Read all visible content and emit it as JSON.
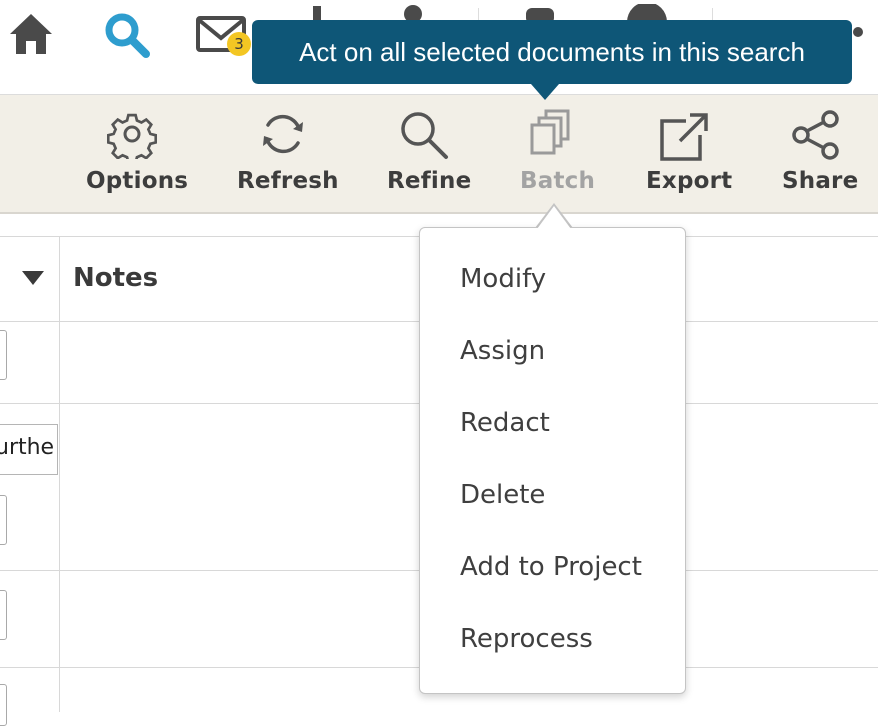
{
  "topnav": {
    "icons": [
      "home-icon",
      "search-icon",
      "mail-icon",
      "user-icon",
      "notifications-icon",
      "account-icon",
      "more-icon"
    ],
    "mail_badge": "3",
    "colors": {
      "search": "#2e9dce",
      "icons": "#4a4a4a",
      "badge": "#f3c623"
    }
  },
  "tooltip": {
    "text": "Act on all selected documents in this search",
    "color": "#0e5677"
  },
  "toolbar": {
    "options_label": "Options",
    "refresh_label": "Refresh",
    "refine_label": "Refine",
    "batch_label": "Batch",
    "export_label": "Export",
    "share_label": "Share"
  },
  "table": {
    "notes_header": "Notes",
    "partial_cell_text": "urthe"
  },
  "batch_menu": {
    "items": [
      "Modify",
      "Assign",
      "Redact",
      "Delete",
      "Add to Project",
      "Reprocess"
    ]
  }
}
